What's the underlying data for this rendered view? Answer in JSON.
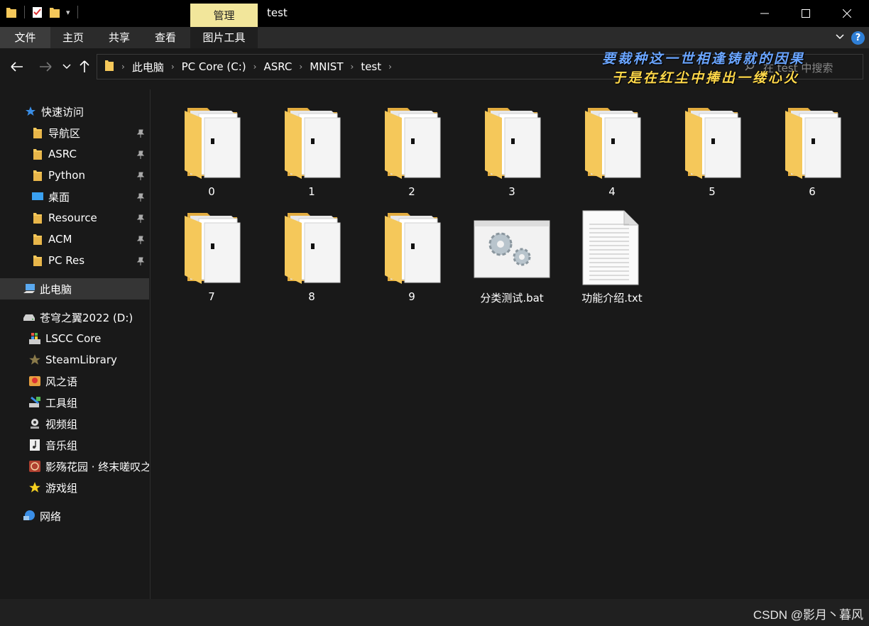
{
  "window": {
    "title": "test",
    "context_tab": "管理"
  },
  "ribbon": {
    "tabs": [
      "文件",
      "主页",
      "共享",
      "查看",
      "图片工具"
    ]
  },
  "address": {
    "breadcrumb": [
      "此电脑",
      "PC Core (C:)",
      "ASRC",
      "MNIST",
      "test"
    ],
    "search_placeholder": "在 test 中搜索"
  },
  "overlay_poem": {
    "line1": "要裁种这一世相逢铸就的因果",
    "line2": "于是在红尘中捧出一缕心火"
  },
  "sidebar": {
    "quick_access": "快速访问",
    "pinned": [
      {
        "label": "导航区",
        "icon": "folder-icon"
      },
      {
        "label": "ASRC",
        "icon": "folder-icon"
      },
      {
        "label": "Python",
        "icon": "folder-icon"
      },
      {
        "label": "桌面",
        "icon": "desktop-icon"
      },
      {
        "label": "Resource",
        "icon": "folder-icon"
      },
      {
        "label": "ACM",
        "icon": "folder-icon"
      },
      {
        "label": "PC Res",
        "icon": "folder-icon"
      }
    ],
    "this_pc": "此电脑",
    "drives": [
      {
        "label": "苍穹之翼2022 (D:)",
        "icon": "drive-icon"
      },
      {
        "label": "LSCC Core",
        "icon": "windows-drive-icon"
      },
      {
        "label": "SteamLibrary",
        "icon": "star-drive-icon"
      },
      {
        "label": "风之语",
        "icon": "app-drive-icon"
      },
      {
        "label": "工具组",
        "icon": "tools-drive-icon"
      },
      {
        "label": "视频组",
        "icon": "webcam-drive-icon"
      },
      {
        "label": "音乐组",
        "icon": "music-drive-icon"
      },
      {
        "label": "影殇花园 · 终末嗟叹之",
        "icon": "garden-drive-icon"
      },
      {
        "label": "游戏组",
        "icon": "star-icon"
      }
    ],
    "network": "网络"
  },
  "files": [
    {
      "name": "0",
      "type": "folder"
    },
    {
      "name": "1",
      "type": "folder"
    },
    {
      "name": "2",
      "type": "folder"
    },
    {
      "name": "3",
      "type": "folder"
    },
    {
      "name": "4",
      "type": "folder"
    },
    {
      "name": "5",
      "type": "folder"
    },
    {
      "name": "6",
      "type": "folder"
    },
    {
      "name": "7",
      "type": "folder"
    },
    {
      "name": "8",
      "type": "folder"
    },
    {
      "name": "9",
      "type": "folder"
    },
    {
      "name": "分类测试.bat",
      "type": "bat"
    },
    {
      "name": "功能介绍.txt",
      "type": "txt"
    }
  ],
  "watermark": "CSDN @影月丶暮风",
  "colors": {
    "background": "#191919",
    "folder": "#f5c85a",
    "context_tab": "#f2e69b",
    "accent_blue": "#2f7fd6"
  }
}
